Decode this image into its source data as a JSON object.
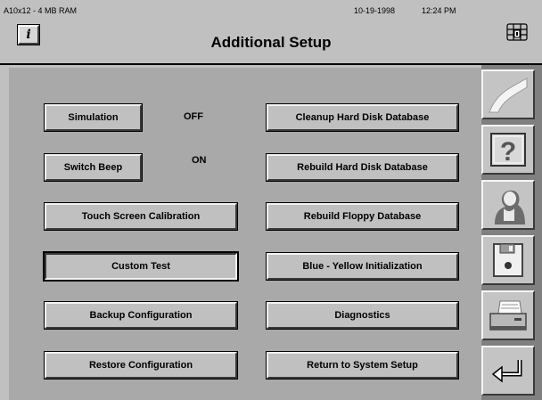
{
  "header": {
    "ram_info": "A10x12 - 4 MB RAM",
    "date": "10-19-1998",
    "time": "12:24 PM",
    "title": "Additional Setup",
    "info_button": "i"
  },
  "buttons": {
    "simulation": "Simulation",
    "switch_beep": "Switch Beep",
    "touch_screen_calibration": "Touch Screen Calibration",
    "custom_test": "Custom Test",
    "backup_configuration": "Backup Configuration",
    "restore_configuration": "Restore Configuration",
    "cleanup_hd_database": "Cleanup Hard Disk Database",
    "rebuild_hd_database": "Rebuild Hard Disk Database",
    "rebuild_floppy_database": "Rebuild Floppy Database",
    "blue_yellow_init": "Blue - Yellow Initialization",
    "diagnostics": "Diagnostics",
    "return_system_setup": "Return to System Setup"
  },
  "status": {
    "simulation": "OFF",
    "switch_beep": "ON"
  },
  "toolbar": {
    "icons": [
      "curve-icon",
      "help-question-icon",
      "operator-person-icon",
      "floppy-disk-icon",
      "printer-icon",
      "return-arrow-icon"
    ]
  },
  "colors": {
    "background": "#c0c0c0",
    "panel": "#a9a9a9",
    "toolbar": "#808080"
  }
}
